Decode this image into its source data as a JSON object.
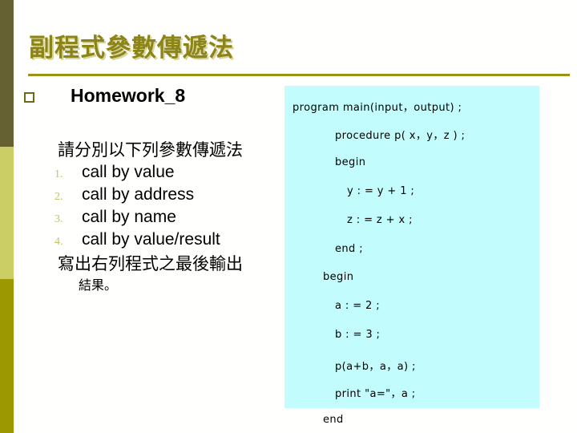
{
  "slide": {
    "title": "副程式參數傳遞法",
    "bullet_icon": "hollow-square-bullet",
    "heading": "Homework_8",
    "intro": "請分別以下列參數傳遞法",
    "methods": [
      {
        "num": "1.",
        "label": "call by value"
      },
      {
        "num": "2.",
        "label": "call by address"
      },
      {
        "num": "3.",
        "label": "call by name"
      },
      {
        "num": "4.",
        "label": "call by value/result"
      }
    ],
    "outro_line1": "寫出右列程式之最後輸出",
    "outro_line2": "結果。"
  },
  "code_panel": {
    "lines": [
      "program  main(input，output) ;",
      "procedure  p( x，y，z ) ;",
      "begin",
      "y : = y + 1 ;",
      "z : = z + x ;",
      "end ;",
      "begin",
      "a : = 2 ;",
      "b : = 3 ;",
      "p(a+b，a，a) ;",
      "print \"a=\"，a ;",
      "end"
    ]
  },
  "colors": {
    "band_top": "#666132",
    "band_mid": "#cbcd65",
    "band_bottom": "#9a9a00",
    "title_text": "#8c8416",
    "rule": "#9a9116",
    "code_panel_bg": "#c2fcfc",
    "list_number": "#c2c46a",
    "body_text": "#000000"
  }
}
